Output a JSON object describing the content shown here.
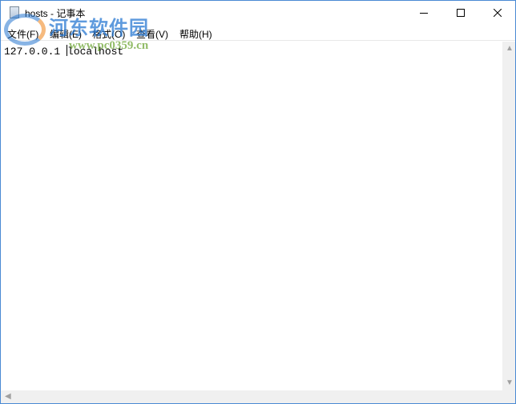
{
  "window": {
    "title": "hosts - 记事本"
  },
  "menu": [
    {
      "label": "文件(F)"
    },
    {
      "label": "编辑(E)"
    },
    {
      "label": "格式(O)"
    },
    {
      "label": "查看(V)"
    },
    {
      "label": "帮助(H)"
    }
  ],
  "editor": {
    "content": "127.0.0.1 ",
    "content_after_caret": "localhost"
  },
  "watermark": {
    "name": "河东软件园",
    "url": "www.pc0359.cn"
  },
  "icons": {
    "minimize": "minimize-icon",
    "maximize": "maximize-icon",
    "close": "close-icon"
  }
}
